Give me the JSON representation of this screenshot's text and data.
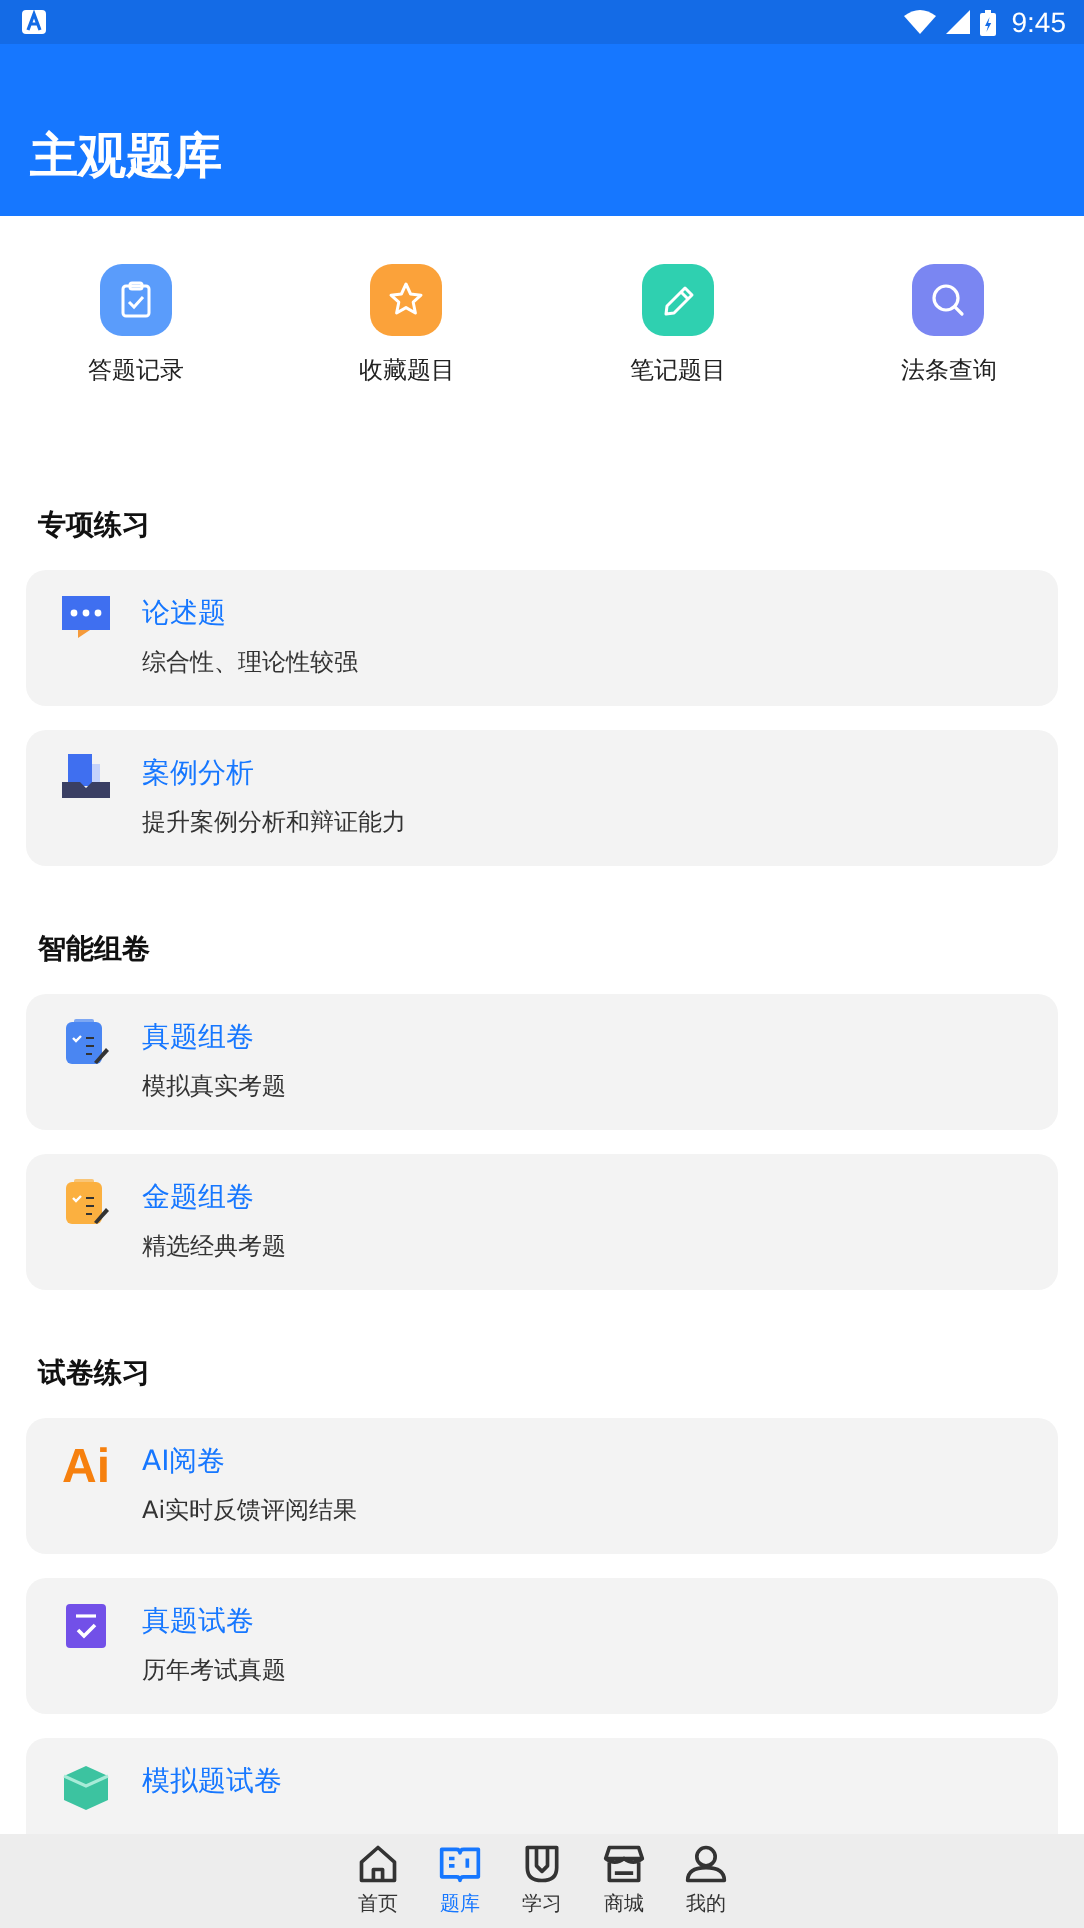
{
  "status_bar": {
    "time": "9:45"
  },
  "header": {
    "title": "主观题库"
  },
  "quick_links": [
    {
      "label": "答题记录",
      "kind": "clipboard",
      "color": "#5a9cfb"
    },
    {
      "label": "收藏题目",
      "kind": "star",
      "color": "#fba23a"
    },
    {
      "label": "笔记题目",
      "kind": "pencil",
      "color": "#2fd0b0"
    },
    {
      "label": "法条查询",
      "kind": "search",
      "color": "#7a86f2"
    }
  ],
  "sections": [
    {
      "title": "专项练习",
      "items": [
        {
          "title": "论述题",
          "subtitle": "综合性、理论性较强",
          "kind": "chat"
        },
        {
          "title": "案例分析",
          "subtitle": "提升案例分析和辩证能力",
          "kind": "tray"
        }
      ]
    },
    {
      "title": "智能组卷",
      "items": [
        {
          "title": "真题组卷",
          "subtitle": "模拟真实考题",
          "kind": "clipboard",
          "color": "#4a86f2"
        },
        {
          "title": "金题组卷",
          "subtitle": "精选经典考题",
          "kind": "clipboard",
          "color": "#fbb040"
        }
      ]
    },
    {
      "title": "试卷练习",
      "items": [
        {
          "title": "AI阅卷",
          "subtitle": "Ai实时反馈评阅结果",
          "kind": "text",
          "icon_text": "Ai"
        },
        {
          "title": "真题试卷",
          "subtitle": "历年考试真题",
          "kind": "check"
        },
        {
          "title": "模拟题试卷",
          "kind": "cube"
        }
      ]
    }
  ],
  "bottom_nav": [
    {
      "label": "首页",
      "kind": "home",
      "selected": false
    },
    {
      "label": "题库",
      "kind": "book",
      "selected": true
    },
    {
      "label": "学习",
      "kind": "pencil-cup",
      "selected": false
    },
    {
      "label": "商城",
      "kind": "shop",
      "selected": false
    },
    {
      "label": "我的",
      "kind": "person",
      "selected": false
    }
  ]
}
